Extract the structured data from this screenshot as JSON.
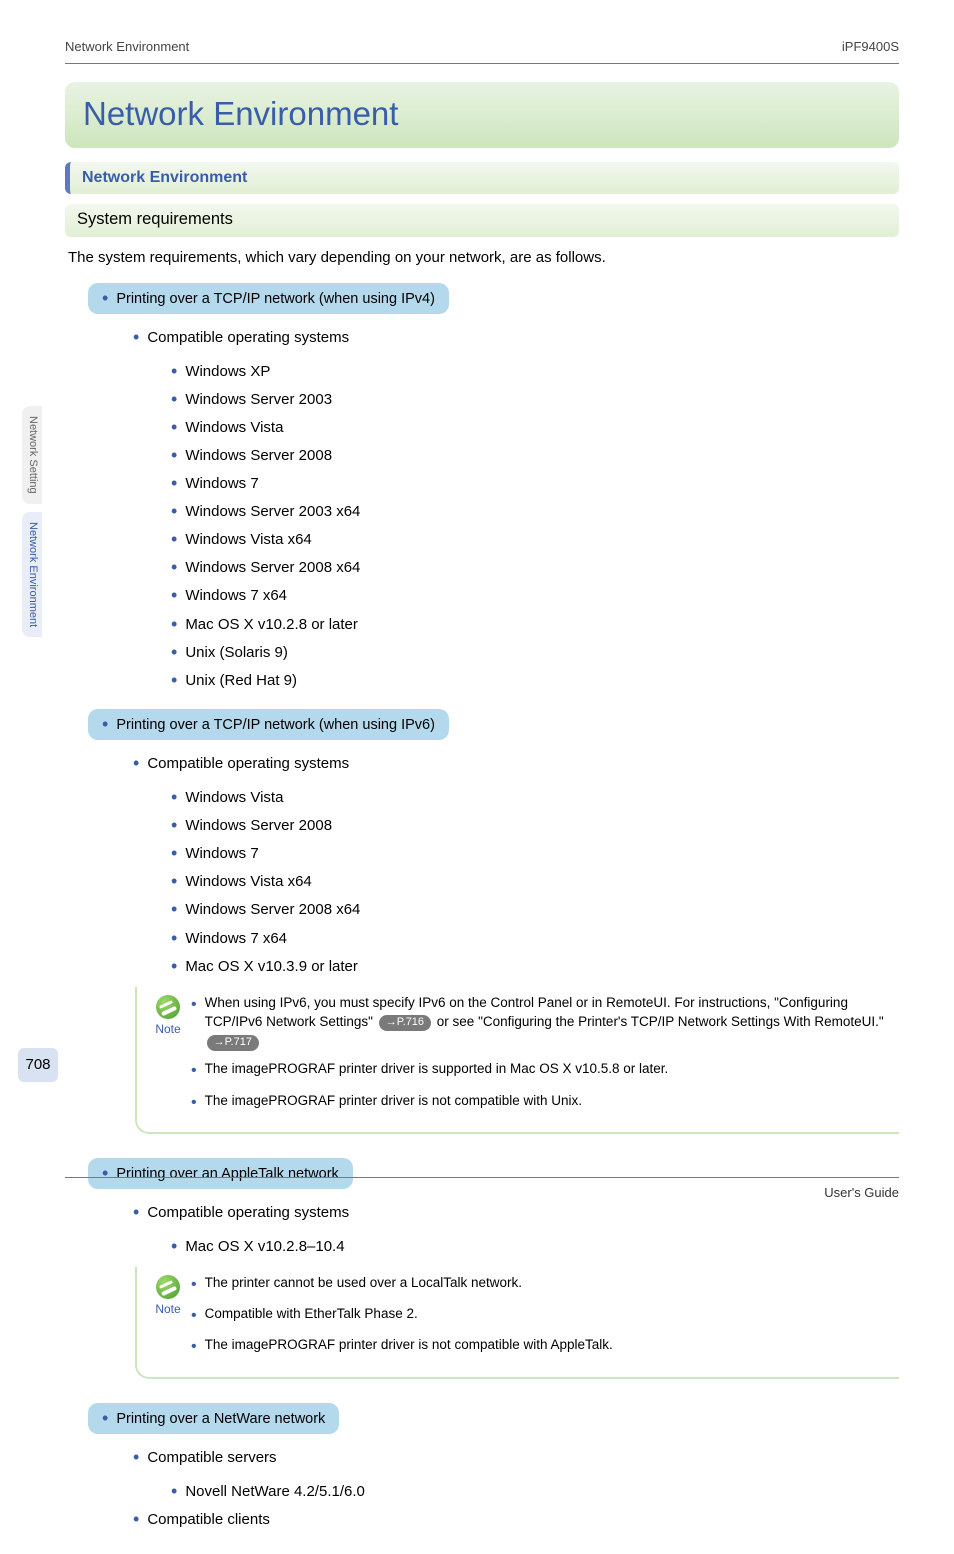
{
  "header": {
    "left": "Network Environment",
    "right": "iPF9400S"
  },
  "title": "Network Environment",
  "section_title": "Network Environment",
  "subsection": "System requirements",
  "intro": "The system requirements, which vary depending on your network, are as follows.",
  "side_tabs": [
    {
      "label": "Network Setting",
      "active": false
    },
    {
      "label": "Network Environment",
      "active": true
    }
  ],
  "page_number": "708",
  "footer": "User's Guide",
  "groups": [
    {
      "tag": "Printing over a TCP/IP network (when using IPv4)",
      "subhead": "Compatible operating systems",
      "items": [
        "Windows XP",
        "Windows Server 2003",
        "Windows Vista",
        "Windows Server 2008",
        "Windows 7",
        "Windows Server 2003 x64",
        "Windows Vista x64",
        "Windows Server 2008 x64",
        "Windows 7 x64",
        "Mac OS X v10.2.8 or later",
        "Unix (Solaris 9)",
        "Unix (Red Hat 9)"
      ]
    },
    {
      "tag": "Printing over a TCP/IP network (when using IPv6)",
      "subhead": "Compatible operating systems",
      "items": [
        "Windows Vista",
        "Windows Server 2008",
        "Windows 7",
        "Windows Vista x64",
        "Windows Server 2008 x64",
        "Windows 7 x64",
        "Mac OS X v10.3.9 or later"
      ],
      "note": {
        "lines": [
          {
            "pre": "When using IPv6, you must specify IPv6 on the Control Panel or in RemoteUI. For instructions, \"Configuring TCP/IPv6 Network Settings\" ",
            "link1": "→P.716",
            "mid": " or see \"Configuring the Printer's TCP/IP Network Settings With RemoteUI.\" ",
            "link2": "→P.717"
          },
          {
            "text": "The imagePROGRAF printer driver is supported in Mac OS X v10.5.8 or later."
          },
          {
            "text": "The imagePROGRAF printer driver is not compatible with Unix."
          }
        ]
      }
    },
    {
      "tag": "Printing over an AppleTalk network",
      "subhead": "Compatible operating systems",
      "items": [
        "Mac OS X v10.2.8–10.4"
      ],
      "note": {
        "lines": [
          {
            "text": "The printer cannot be used over a LocalTalk network."
          },
          {
            "text": "Compatible with EtherTalk Phase 2."
          },
          {
            "text": "The imagePROGRAF printer driver is not compatible with AppleTalk."
          }
        ]
      }
    },
    {
      "tag": "Printing over a NetWare network",
      "subhead": "Compatible servers",
      "items": [
        "Novell NetWare 4.2/5.1/6.0"
      ],
      "extra_subhead": "Compatible clients"
    }
  ],
  "note_label": "Note"
}
